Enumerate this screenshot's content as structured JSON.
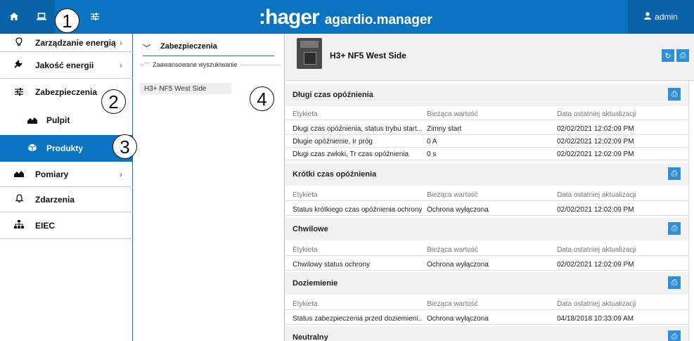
{
  "topbar": {
    "home_icon": "home-icon",
    "laptop_icon": "laptop-icon",
    "filter_icon": "sliders-icon",
    "brand": ":hager",
    "app_name": "agardio.manager",
    "user": "admin",
    "color": "#0a74c2"
  },
  "callouts": [
    "1",
    "2",
    "3",
    "4"
  ],
  "sidebar": {
    "items": [
      {
        "label": "Zarządzanie energią",
        "icon": "lightbulb-icon"
      },
      {
        "label": "Jakość energii",
        "icon": "plug-icon"
      },
      {
        "label": "Zabezpieczenia",
        "icon": "sliders-icon"
      },
      {
        "label": "Pulpit",
        "icon": "area-chart-icon"
      },
      {
        "label": "Produkty",
        "icon": "cube-icon"
      },
      {
        "label": "Pomiary",
        "icon": "area-chart-icon"
      },
      {
        "label": "Zdarzenia",
        "icon": "bell-icon"
      },
      {
        "label": "EIEC",
        "icon": "sitemap-icon"
      }
    ]
  },
  "tree": {
    "header": "Zabezpieczenia",
    "advanced_search": "Zaawansowane wyszukiwanie",
    "item": "H3+ NF5 West Side"
  },
  "device": {
    "title": "H3+ NF5 West Side"
  },
  "columns": [
    "Etykieta",
    "Bieżąca wartość",
    "Data ostatniej aktualizacji"
  ],
  "sections": [
    {
      "title": "Długi czas opóźnienia",
      "rows": [
        [
          "Długi czas opóźnienia, status trybu start...",
          "Zimny start",
          "02/02/2021 12:02:09 PM"
        ],
        [
          "Długie opóźnienie, Ir  próg",
          "0 A",
          "02/02/2021 12:02:09 PM"
        ],
        [
          "Długi czas zwłoki, Tr czas opóźnienia",
          "0 s",
          "02/02/2021 12:02:09 PM"
        ]
      ]
    },
    {
      "title": "Krótki czas opóźnienia",
      "rows": [
        [
          "Status krótkiego czas opóźnienia ochrony",
          "Ochrona wyłączona",
          "02/02/2021 12:02:09 PM"
        ]
      ]
    },
    {
      "title": "Chwilowe",
      "rows": [
        [
          "Chwilowy status ochrony",
          "Ochrona wyłączona",
          "02/02/2021 12:02:09 PM"
        ]
      ]
    },
    {
      "title": "Doziemienie",
      "rows": [
        [
          "Status zabezpieczenia przed doziemieni...",
          "Ochrona wyłączona",
          "04/18/2018 10:33:09 AM"
        ]
      ]
    },
    {
      "title": "Neutralny",
      "rows": []
    }
  ]
}
